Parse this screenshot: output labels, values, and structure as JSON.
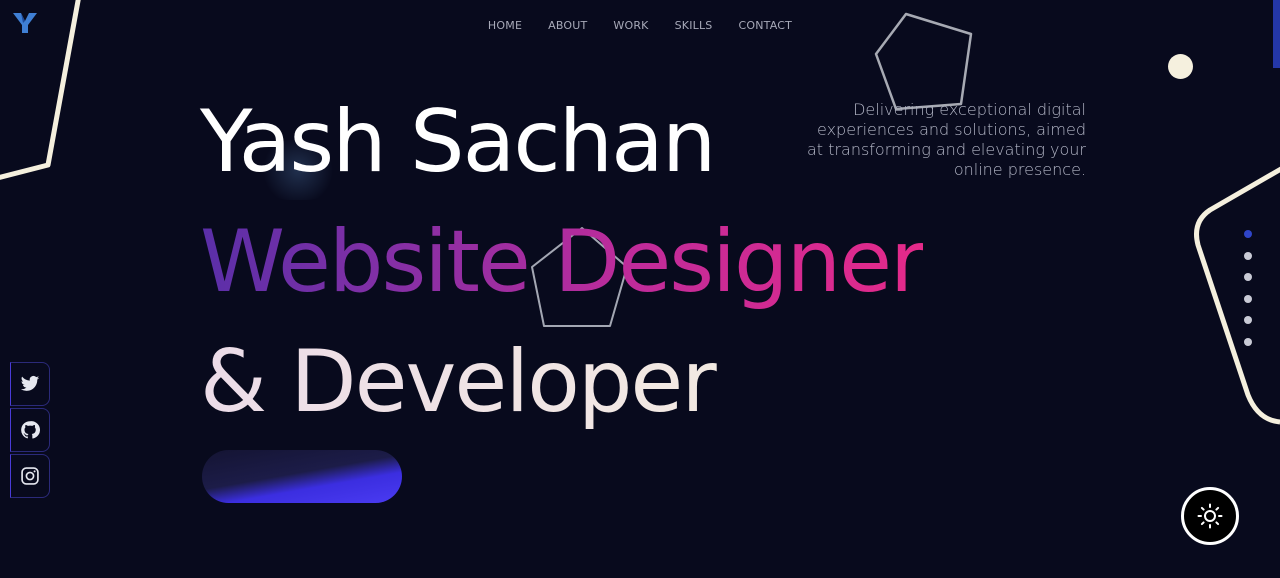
{
  "brand": {
    "logo_icon": "y-logo-icon",
    "accent": "#2437a8"
  },
  "nav": {
    "items": [
      {
        "label": "HOME"
      },
      {
        "label": "ABOUT"
      },
      {
        "label": "WORK"
      },
      {
        "label": "SKILLS"
      },
      {
        "label": "CONTACT"
      }
    ]
  },
  "hero": {
    "line1": "Yash Sachan",
    "line2": "Website Designer",
    "line3": "& Developer",
    "tagline": "Delivering exceptional digital experiences and solutions, aimed at transforming and elevating your online presence.",
    "gradient_colors": [
      "#5a2fa8",
      "#e52a8a"
    ]
  },
  "cta": {
    "label": ""
  },
  "social": {
    "items": [
      {
        "icon": "twitter-icon"
      },
      {
        "icon": "github-icon"
      },
      {
        "icon": "instagram-icon"
      }
    ]
  },
  "section_dots": {
    "count": 6,
    "active_index": 0
  },
  "theme_toggle": {
    "icon": "sun-icon"
  }
}
